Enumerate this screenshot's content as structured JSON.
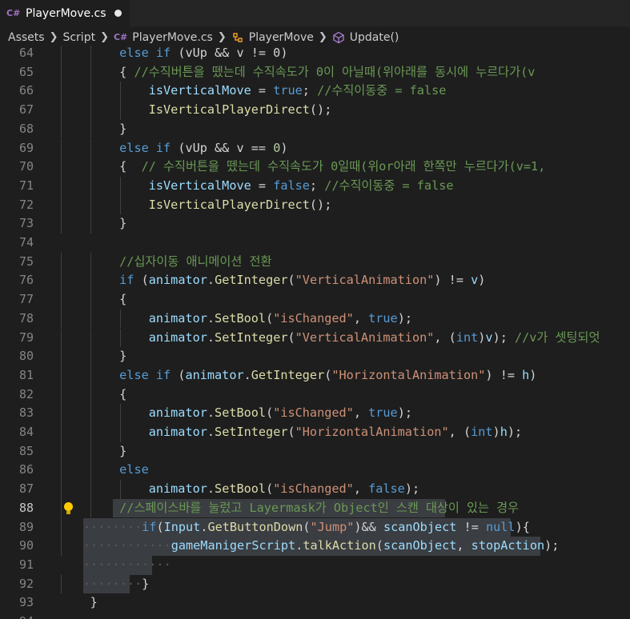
{
  "tab": {
    "icon": "C#",
    "title": "PlayerMove.cs",
    "modified": true
  },
  "breadcrumb": {
    "assets": "Assets",
    "script": "Script",
    "file": "PlayerMove.cs",
    "class": "PlayerMove",
    "method": "Update()"
  },
  "editor": {
    "active_line": 88,
    "lines": [
      {
        "n": "64",
        "indent": 2,
        "t": [
          [
            "k",
            "else if"
          ],
          [
            "p",
            " (vUp && v != 0)"
          ]
        ]
      },
      {
        "n": "65",
        "indent": 2,
        "t": [
          [
            "p",
            "{ "
          ],
          [
            "c",
            "//수직버튼을 뗐는데 수직속도가 0이 아닐때(위아래를 동시에 누르다가(v"
          ]
        ]
      },
      {
        "n": "66",
        "indent": 3,
        "t": [
          [
            "v",
            "isVerticalMove"
          ],
          [
            "p",
            " = "
          ],
          [
            "k",
            "true"
          ],
          [
            "p",
            "; "
          ],
          [
            "c",
            "//수직이동중 = false"
          ]
        ]
      },
      {
        "n": "67",
        "indent": 3,
        "t": [
          [
            "f",
            "IsVerticalPlayerDirect"
          ],
          [
            "p",
            "();"
          ]
        ]
      },
      {
        "n": "68",
        "indent": 2,
        "t": [
          [
            "p",
            "}"
          ]
        ]
      },
      {
        "n": "69",
        "indent": 2,
        "t": [
          [
            "k",
            "else if"
          ],
          [
            "p",
            " (vUp && v == "
          ],
          [
            "n",
            "0"
          ],
          [
            "p",
            ")"
          ]
        ]
      },
      {
        "n": "70",
        "indent": 2,
        "t": [
          [
            "p",
            "{  "
          ],
          [
            "c",
            "// 수직버튼을 뗐는데 수직속도가 0일때(위or아래 한쪽만 누르다가(v=1,"
          ]
        ]
      },
      {
        "n": "71",
        "indent": 3,
        "t": [
          [
            "v",
            "isVerticalMove"
          ],
          [
            "p",
            " = "
          ],
          [
            "k",
            "false"
          ],
          [
            "p",
            "; "
          ],
          [
            "c",
            "//수직이동중 = false"
          ]
        ]
      },
      {
        "n": "72",
        "indent": 3,
        "t": [
          [
            "f",
            "IsVerticalPlayerDirect"
          ],
          [
            "p",
            "();"
          ]
        ]
      },
      {
        "n": "73",
        "indent": 2,
        "t": [
          [
            "p",
            "}"
          ]
        ]
      },
      {
        "n": "74",
        "indent": 0,
        "t": []
      },
      {
        "n": "75",
        "indent": 2,
        "t": [
          [
            "c",
            "//십자이동 애니메이션 전환"
          ]
        ]
      },
      {
        "n": "76",
        "indent": 2,
        "t": [
          [
            "k",
            "if"
          ],
          [
            "p",
            " ("
          ],
          [
            "v",
            "animator"
          ],
          [
            "p",
            "."
          ],
          [
            "f",
            "GetInteger"
          ],
          [
            "p",
            "("
          ],
          [
            "s",
            "\"VerticalAnimation\""
          ],
          [
            "p",
            ") != "
          ],
          [
            "v",
            "v"
          ],
          [
            "p",
            ")"
          ]
        ]
      },
      {
        "n": "77",
        "indent": 2,
        "t": [
          [
            "p",
            "{"
          ]
        ]
      },
      {
        "n": "78",
        "indent": 3,
        "t": [
          [
            "v",
            "animator"
          ],
          [
            "p",
            "."
          ],
          [
            "f",
            "SetBool"
          ],
          [
            "p",
            "("
          ],
          [
            "s",
            "\"isChanged\""
          ],
          [
            "p",
            ", "
          ],
          [
            "k",
            "true"
          ],
          [
            "p",
            ");"
          ]
        ]
      },
      {
        "n": "79",
        "indent": 3,
        "t": [
          [
            "v",
            "animator"
          ],
          [
            "p",
            "."
          ],
          [
            "f",
            "SetInteger"
          ],
          [
            "p",
            "("
          ],
          [
            "s",
            "\"VerticalAnimation\""
          ],
          [
            "p",
            ", ("
          ],
          [
            "k",
            "int"
          ],
          [
            "p",
            ")"
          ],
          [
            "v",
            "v"
          ],
          [
            "p",
            "); "
          ],
          [
            "c",
            "//v가 셋팅되엇"
          ]
        ]
      },
      {
        "n": "80",
        "indent": 2,
        "t": [
          [
            "p",
            "}"
          ]
        ]
      },
      {
        "n": "81",
        "indent": 2,
        "t": [
          [
            "k",
            "else if"
          ],
          [
            "p",
            " ("
          ],
          [
            "v",
            "animator"
          ],
          [
            "p",
            "."
          ],
          [
            "f",
            "GetInteger"
          ],
          [
            "p",
            "("
          ],
          [
            "s",
            "\"HorizontalAnimation\""
          ],
          [
            "p",
            ") != "
          ],
          [
            "v",
            "h"
          ],
          [
            "p",
            ")"
          ]
        ]
      },
      {
        "n": "82",
        "indent": 2,
        "t": [
          [
            "p",
            "{"
          ]
        ]
      },
      {
        "n": "83",
        "indent": 3,
        "t": [
          [
            "v",
            "animator"
          ],
          [
            "p",
            "."
          ],
          [
            "f",
            "SetBool"
          ],
          [
            "p",
            "("
          ],
          [
            "s",
            "\"isChanged\""
          ],
          [
            "p",
            ", "
          ],
          [
            "k",
            "true"
          ],
          [
            "p",
            ");"
          ]
        ]
      },
      {
        "n": "84",
        "indent": 3,
        "t": [
          [
            "v",
            "animator"
          ],
          [
            "p",
            "."
          ],
          [
            "f",
            "SetInteger"
          ],
          [
            "p",
            "("
          ],
          [
            "s",
            "\"HorizontalAnimation\""
          ],
          [
            "p",
            ", ("
          ],
          [
            "k",
            "int"
          ],
          [
            "p",
            ")"
          ],
          [
            "v",
            "h"
          ],
          [
            "p",
            ");"
          ]
        ]
      },
      {
        "n": "85",
        "indent": 2,
        "t": [
          [
            "p",
            "}"
          ]
        ]
      },
      {
        "n": "86",
        "indent": 2,
        "t": [
          [
            "k",
            "else"
          ]
        ]
      },
      {
        "n": "87",
        "indent": 3,
        "t": [
          [
            "v",
            "animator"
          ],
          [
            "p",
            "."
          ],
          [
            "f",
            "SetBool"
          ],
          [
            "p",
            "("
          ],
          [
            "s",
            "\"isChanged\""
          ],
          [
            "p",
            ", "
          ],
          [
            "k",
            "false"
          ],
          [
            "p",
            ");"
          ]
        ]
      },
      {
        "n": "88",
        "indent": 2,
        "bulb": true,
        "sel": true,
        "t": [
          [
            "c",
            "//스페이스바를 눌렀고 Layermask가 Object인 스캔 대상이 있는 경우"
          ]
        ]
      },
      {
        "n": "89",
        "indent": 2,
        "sel": true,
        "dots": "········",
        "t": [
          [
            "k",
            "if"
          ],
          [
            "p",
            "("
          ],
          [
            "v",
            "Input"
          ],
          [
            "p",
            "."
          ],
          [
            "f",
            "GetButtonDown"
          ],
          [
            "p",
            "("
          ],
          [
            "s",
            "\"Jump\""
          ],
          [
            "p",
            ")&& "
          ],
          [
            "v",
            "scanObject"
          ],
          [
            "p",
            " != "
          ],
          [
            "k",
            "null"
          ],
          [
            "p",
            "){"
          ]
        ]
      },
      {
        "n": "90",
        "indent": 3,
        "sel": true,
        "dots": "············",
        "t": [
          [
            "v",
            "gameManigerScript"
          ],
          [
            "p",
            "."
          ],
          [
            "f",
            "talkAction"
          ],
          [
            "p",
            "("
          ],
          [
            "v",
            "scanObject"
          ],
          [
            "p",
            ", "
          ],
          [
            "v",
            "stopAction"
          ],
          [
            "p",
            ");"
          ]
        ]
      },
      {
        "n": "91",
        "indent": 0,
        "sel": true,
        "dots": "············",
        "t": []
      },
      {
        "n": "92",
        "indent": 2,
        "sel": true,
        "dots": "········",
        "t": [
          [
            "p",
            "}"
          ]
        ]
      },
      {
        "n": "93",
        "indent": 1,
        "t": [
          [
            "p",
            "}"
          ]
        ]
      },
      {
        "n": "94",
        "indent": 0,
        "t": []
      }
    ]
  },
  "colors": {
    "background": "#1e1e1e",
    "keyword": "#569cd6",
    "comment": "#6a9955",
    "string": "#ce9178",
    "variable": "#9cdcfe",
    "function": "#dcdcaa",
    "number": "#b5cea8",
    "selection": "#3a3d41"
  }
}
